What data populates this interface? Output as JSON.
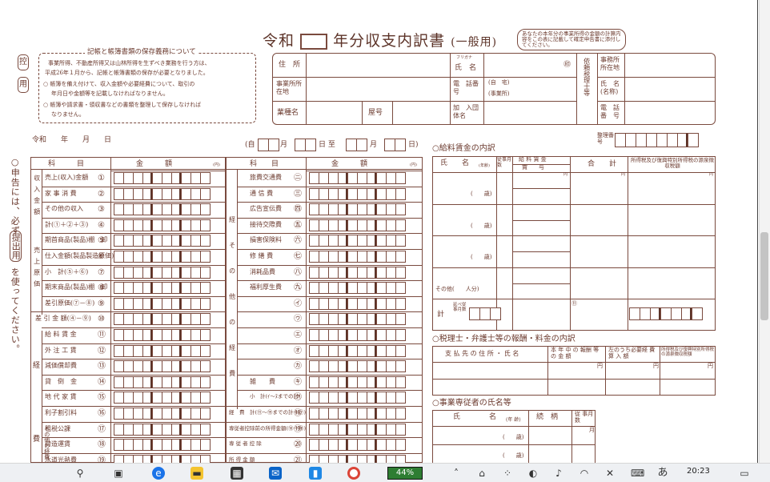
{
  "doc": {
    "title_prefix": "令和",
    "title_suffix": "年分収支内訳書",
    "title_kind": "(一般用)",
    "notice": "あなたの本年分の事業所得の金額の計算内容をこの表に記載して確定申告書に添付してください。",
    "control": "控",
    "use": "用",
    "storage_title": "記帳と帳簿書類の保存義務について",
    "storage_line1": "事業所得、不動産所得又は山林所得を生ずべき業務を行う方は、",
    "storage_line2": "平成26年１月から、記帳と帳簿書類の保存が必要となりました。",
    "storage_item1a": "○ 帳簿を備え付けて、収入金額や必要経費について、取引の",
    "storage_item1b": "年月日や金額等を記載しなければなりません。",
    "storage_item2a": "○ 帳簿や請求書・領収書などの書類を整理して保存しなければ",
    "storage_item2b": "なりません。",
    "side_note_1": "○申告には、必ず",
    "side_note_2": "提出用",
    "side_note_3": "を使ってください。",
    "date_line": "令和　　年　　月　　日",
    "period_from": "(自",
    "period_month": "月",
    "period_day": "日 至",
    "period_end": "日)"
  },
  "header_form": {
    "address": "住　所",
    "furigana": "フリガナ",
    "name": "氏　名",
    "seal": "㊞",
    "office_addr": "事業所所在地",
    "phone": "電　話番　号",
    "phone_home": "(自　宅)",
    "phone_office": "(事業所)",
    "business_type": "業種名",
    "trade_name": "屋号",
    "group": "加　入団体名",
    "agent_label": "依頼税理士等",
    "agent_office": "事務所所在地",
    "agent_name": "氏　名(名称)",
    "agent_phone": "電　話番　号",
    "ref_no": "整理番号"
  },
  "left_table": {
    "col_item": "科　　　目",
    "col_amount": "金　　　額",
    "yen": "(円)",
    "group_income": "収入金額",
    "group_cost": "売上原価",
    "group_exp": "経",
    "group_exp2": "費",
    "rows": [
      {
        "label": "売上(収入)金額",
        "num": "①"
      },
      {
        "label": "家 事 消 費",
        "num": "②"
      },
      {
        "label": "その他の収入",
        "num": "③"
      },
      {
        "label": "計(①＋②＋③)",
        "num": "④"
      },
      {
        "label": "期首商品(製品)棚　卸　高",
        "num": "⑤"
      },
      {
        "label": "仕入金額(製品製造原価)",
        "num": "⑥"
      },
      {
        "label": "小　計(⑤＋⑥)",
        "num": "⑦"
      },
      {
        "label": "期末商品(製品)棚　卸　高",
        "num": "⑧"
      },
      {
        "label": "差引原価(⑦－⑧)",
        "num": "⑨"
      },
      {
        "label": "差 引 金 額(④－⑨)",
        "num": "⑩"
      },
      {
        "label": "給 料 賃 金",
        "num": "⑪"
      },
      {
        "label": "外 注 工 賃",
        "num": "⑫"
      },
      {
        "label": "減価償却費",
        "num": "⑬"
      },
      {
        "label": "貸　倒　金",
        "num": "⑭"
      },
      {
        "label": "地 代 家 賃",
        "num": "⑮"
      },
      {
        "label": "利子割引料",
        "num": "⑯"
      },
      {
        "label": "租税公課",
        "num": "⑰"
      },
      {
        "label": "荷造運賃",
        "num": "⑱"
      },
      {
        "label": "水道光熱費",
        "num": "⑲"
      }
    ],
    "other_label": "その他の経費"
  },
  "mid_table": {
    "col_item": "科　　目",
    "col_amount": "金　　　額",
    "yen": "(円)",
    "group_label": "経　そ　の　他　の　経　費",
    "rows": [
      {
        "label": "旅費交通費",
        "num": "㊁"
      },
      {
        "label": "通 信 費",
        "num": "㊂"
      },
      {
        "label": "広告宣伝費",
        "num": "㊃"
      },
      {
        "label": "接待交際費",
        "num": "㊄"
      },
      {
        "label": "損害保険料",
        "num": "㊅"
      },
      {
        "label": "修 繕 費",
        "num": "㊆"
      },
      {
        "label": "消耗品費",
        "num": "㊇"
      },
      {
        "label": "福利厚生費",
        "num": "㊈"
      },
      {
        "label": "",
        "num": "㋑"
      },
      {
        "label": "",
        "num": "㋒"
      },
      {
        "label": "",
        "num": "㋓"
      },
      {
        "label": "",
        "num": "㋔"
      },
      {
        "label": "",
        "num": "㋕"
      },
      {
        "label": "雑　　費",
        "num": "㋖"
      },
      {
        "label": "小　計(ｲ～ﾇまでの計)",
        "num": "㋗"
      },
      {
        "label": "経　費　計(⑪～⑲までの計＋㋗)",
        "num": "⑱"
      },
      {
        "label": "専従者控除前の所得金額(⑩－⑱)",
        "num": "⑲"
      },
      {
        "label": "専 従 者 控 除",
        "num": "⑳"
      },
      {
        "label": "所 得 金 額",
        "num": "㉑"
      }
    ]
  },
  "salary": {
    "title": "○給料賃金の内訳",
    "col_name": "氏　　名",
    "col_age": "(年齢)",
    "col_months": "従事月数",
    "col_pay": "給 料 賃 金",
    "col_bonus": "賞　　与",
    "col_total": "合　　計",
    "col_tax": "所得税及び復興特別所得税の源泉徴収税額",
    "yen": "円",
    "age_mark": "(　　歳)",
    "other": "その他(　　人分)",
    "total": "計",
    "total_months": "延べ従事月数",
    "ref": "⑪"
  },
  "fees": {
    "title": "○税理士・弁護士等の報酬・料金の内訳",
    "col_payee": "支 払 先 の 住 所 ・ 氏 名",
    "col_amount": "本 年 中 の 報酬 等 の 金 額",
    "col_expense": "左のうち必要経 費 算 入 額",
    "col_tax": "所得税及び復興特別所得税の源泉徴収税額",
    "yen": "円"
  },
  "dependents": {
    "title": "○事業専従者の氏名等",
    "col_name": "氏　　　　名",
    "col_age": "(年 齢)",
    "col_rel": "続　柄",
    "col_months": "従 事月 数",
    "age_mark": "(　　歳)",
    "months": "月"
  },
  "taskbar": {
    "battery": "44%",
    "time": "20:23",
    "ime": "あ"
  }
}
